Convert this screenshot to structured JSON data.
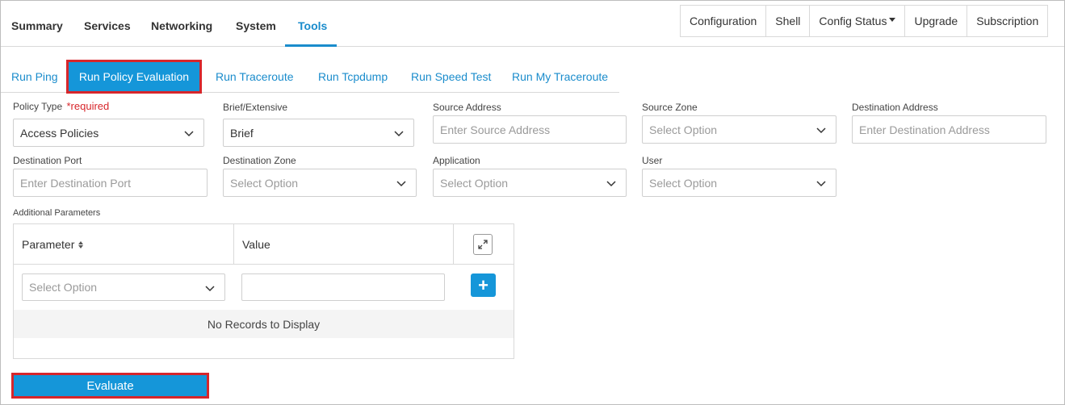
{
  "top_nav": {
    "tabs": [
      "Summary",
      "Services",
      "Networking",
      "System",
      "Tools"
    ],
    "active_tab": "Tools",
    "buttons": [
      "Configuration",
      "Shell",
      "Config Status",
      "Upgrade",
      "Subscription"
    ]
  },
  "sub_tabs": {
    "items": [
      "Run Ping",
      "Run Policy Evaluation",
      "Run Traceroute",
      "Run Tcpdump",
      "Run Speed Test",
      "Run My Traceroute"
    ],
    "active": "Run Policy Evaluation"
  },
  "form": {
    "policy_type": {
      "label": "Policy Type",
      "required_text": "*required",
      "value": "Access Policies"
    },
    "brief_extensive": {
      "label": "Brief/Extensive",
      "value": "Brief"
    },
    "source_address": {
      "label": "Source Address",
      "placeholder": "Enter Source Address"
    },
    "source_zone": {
      "label": "Source Zone",
      "value": "Select Option"
    },
    "destination_address": {
      "label": "Destination Address",
      "placeholder": "Enter Destination Address"
    },
    "destination_port": {
      "label": "Destination Port",
      "placeholder": "Enter Destination Port"
    },
    "destination_zone": {
      "label": "Destination Zone",
      "value": "Select Option"
    },
    "application": {
      "label": "Application",
      "value": "Select Option"
    },
    "user": {
      "label": "User",
      "value": "Select Option"
    }
  },
  "params_table": {
    "label": "Additional Parameters",
    "col_parameter": "Parameter",
    "col_value": "Value",
    "parameter_select": "Select Option",
    "add_symbol": "+",
    "empty_text": "No Records to Display"
  },
  "evaluate_label": "Evaluate",
  "colors": {
    "accent": "#1596d9",
    "highlight_border": "#d7262b",
    "link": "#1a8ccc"
  }
}
